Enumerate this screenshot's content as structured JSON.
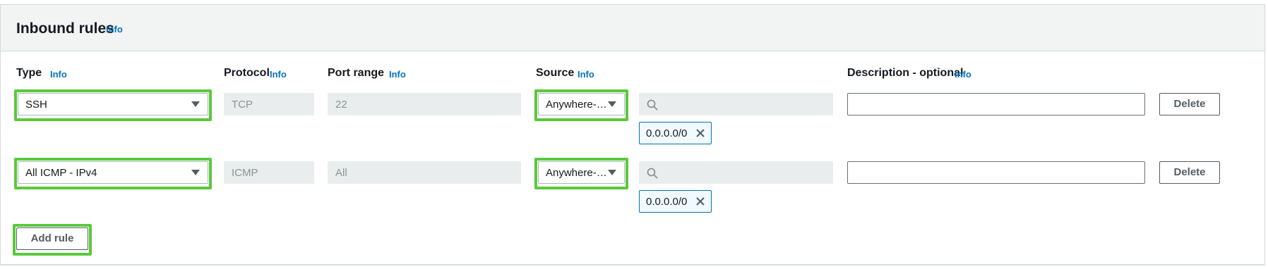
{
  "panel": {
    "title": "Inbound rules",
    "title_info": "Info"
  },
  "columns": {
    "type": {
      "label": "Type",
      "info": "Info"
    },
    "protocol": {
      "label": "Protocol",
      "info": "Info"
    },
    "port_range": {
      "label": "Port range",
      "info": "Info"
    },
    "source": {
      "label": "Source",
      "info": "Info"
    },
    "description": {
      "label": "Description - optional",
      "info": "Info"
    }
  },
  "rules": [
    {
      "type": "SSH",
      "protocol": "TCP",
      "port_range": "22",
      "source": "Anywhere-…",
      "source_search": "",
      "cidr_token": "0.0.0.0/0",
      "description": "",
      "delete_label": "Delete"
    },
    {
      "type": "All ICMP - IPv4",
      "protocol": "ICMP",
      "port_range": "All",
      "source": "Anywhere-…",
      "source_search": "",
      "cidr_token": "0.0.0.0/0",
      "description": "",
      "delete_label": "Delete"
    }
  ],
  "add_rule_label": "Add rule",
  "colors": {
    "highlight": "#5ac93c",
    "link": "#0073bb",
    "token_border": "#0073bb"
  },
  "icons": {
    "search": "search-icon",
    "dropdown": "caret-down-icon",
    "remove": "close-icon"
  }
}
